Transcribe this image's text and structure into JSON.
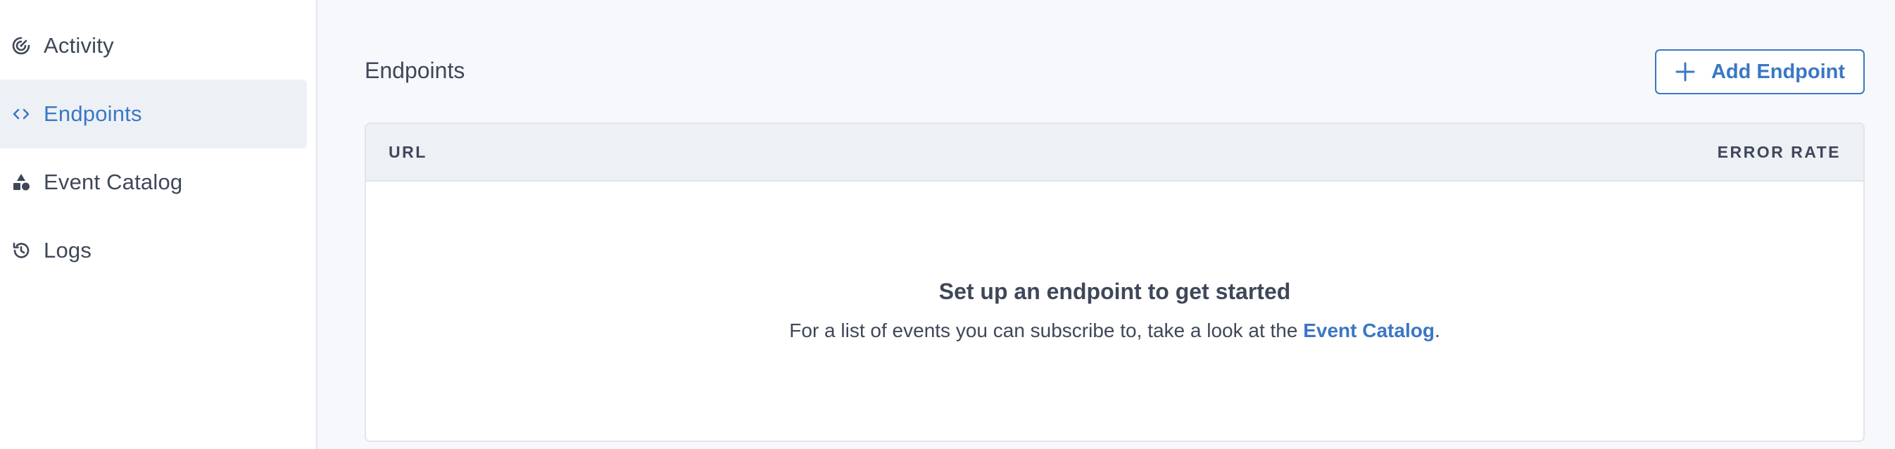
{
  "sidebar": {
    "items": [
      {
        "label": "Activity",
        "icon": "activity-icon",
        "active": false
      },
      {
        "label": "Endpoints",
        "icon": "code-brackets-icon",
        "active": true
      },
      {
        "label": "Event Catalog",
        "icon": "shapes-icon",
        "active": false
      },
      {
        "label": "Logs",
        "icon": "history-icon",
        "active": false
      }
    ]
  },
  "main": {
    "title": "Endpoints",
    "add_button_label": "Add Endpoint",
    "table": {
      "columns": [
        "URL",
        "ERROR RATE"
      ],
      "empty_title": "Set up an endpoint to get started",
      "empty_desc_prefix": "For a list of events you can subscribe to, take a look at the ",
      "empty_desc_link": "Event Catalog",
      "empty_desc_suffix": "."
    }
  },
  "colors": {
    "accent": "#3b77c4",
    "text": "#3f4759",
    "background": "#f7f8fb",
    "active_nav_bg": "#edf1f6"
  }
}
